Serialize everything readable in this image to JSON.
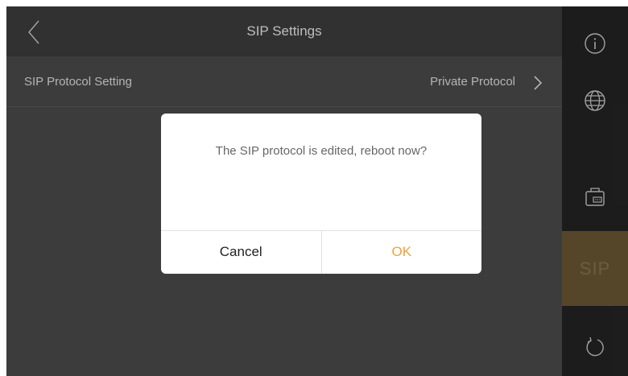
{
  "header": {
    "title": "SIP Settings",
    "back_icon": "chevron-left-icon"
  },
  "settings": {
    "rows": [
      {
        "label": "SIP Protocol Setting",
        "value": "Private Protocol",
        "icon": "chevron-right-icon"
      }
    ]
  },
  "sidebar": {
    "items": [
      {
        "icon": "info-icon",
        "active": false
      },
      {
        "icon": "globe-icon",
        "active": false
      },
      {
        "icon": "device-icon",
        "active": false
      },
      {
        "label": "SIP",
        "icon": "sip-text",
        "active": true
      },
      {
        "icon": "refresh-icon",
        "active": false
      }
    ]
  },
  "dialog": {
    "message": "The SIP protocol is edited, reboot now?",
    "cancel_label": "Cancel",
    "ok_label": "OK"
  },
  "colors": {
    "background": "#4d4d4d",
    "header": "#3f3f3f",
    "sidebar": "#252525",
    "sidebar_active": "#6f5a35",
    "accent": "#f0a03c"
  }
}
